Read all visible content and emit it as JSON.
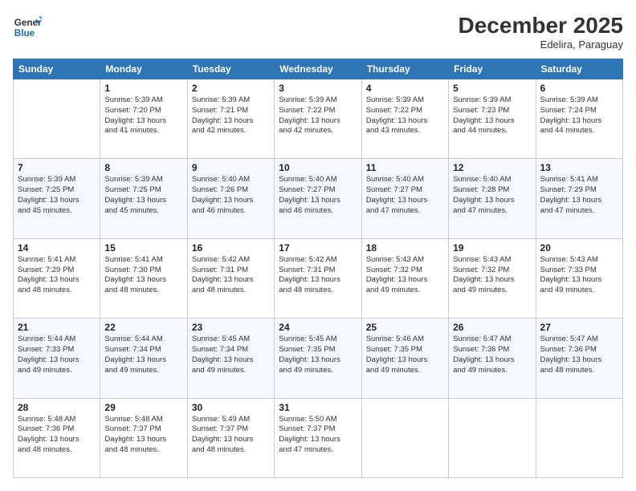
{
  "header": {
    "logo_general": "General",
    "logo_blue": "Blue",
    "month": "December 2025",
    "location": "Edelira, Paraguay"
  },
  "days_of_week": [
    "Sunday",
    "Monday",
    "Tuesday",
    "Wednesday",
    "Thursday",
    "Friday",
    "Saturday"
  ],
  "weeks": [
    [
      {
        "day": "",
        "info": ""
      },
      {
        "day": "1",
        "info": "Sunrise: 5:39 AM\nSunset: 7:20 PM\nDaylight: 13 hours\nand 41 minutes."
      },
      {
        "day": "2",
        "info": "Sunrise: 5:39 AM\nSunset: 7:21 PM\nDaylight: 13 hours\nand 42 minutes."
      },
      {
        "day": "3",
        "info": "Sunrise: 5:39 AM\nSunset: 7:22 PM\nDaylight: 13 hours\nand 42 minutes."
      },
      {
        "day": "4",
        "info": "Sunrise: 5:39 AM\nSunset: 7:22 PM\nDaylight: 13 hours\nand 43 minutes."
      },
      {
        "day": "5",
        "info": "Sunrise: 5:39 AM\nSunset: 7:23 PM\nDaylight: 13 hours\nand 44 minutes."
      },
      {
        "day": "6",
        "info": "Sunrise: 5:39 AM\nSunset: 7:24 PM\nDaylight: 13 hours\nand 44 minutes."
      }
    ],
    [
      {
        "day": "7",
        "info": "Sunrise: 5:39 AM\nSunset: 7:25 PM\nDaylight: 13 hours\nand 45 minutes."
      },
      {
        "day": "8",
        "info": "Sunrise: 5:39 AM\nSunset: 7:25 PM\nDaylight: 13 hours\nand 45 minutes."
      },
      {
        "day": "9",
        "info": "Sunrise: 5:40 AM\nSunset: 7:26 PM\nDaylight: 13 hours\nand 46 minutes."
      },
      {
        "day": "10",
        "info": "Sunrise: 5:40 AM\nSunset: 7:27 PM\nDaylight: 13 hours\nand 46 minutes."
      },
      {
        "day": "11",
        "info": "Sunrise: 5:40 AM\nSunset: 7:27 PM\nDaylight: 13 hours\nand 47 minutes."
      },
      {
        "day": "12",
        "info": "Sunrise: 5:40 AM\nSunset: 7:28 PM\nDaylight: 13 hours\nand 47 minutes."
      },
      {
        "day": "13",
        "info": "Sunrise: 5:41 AM\nSunset: 7:29 PM\nDaylight: 13 hours\nand 47 minutes."
      }
    ],
    [
      {
        "day": "14",
        "info": "Sunrise: 5:41 AM\nSunset: 7:29 PM\nDaylight: 13 hours\nand 48 minutes."
      },
      {
        "day": "15",
        "info": "Sunrise: 5:41 AM\nSunset: 7:30 PM\nDaylight: 13 hours\nand 48 minutes."
      },
      {
        "day": "16",
        "info": "Sunrise: 5:42 AM\nSunset: 7:31 PM\nDaylight: 13 hours\nand 48 minutes."
      },
      {
        "day": "17",
        "info": "Sunrise: 5:42 AM\nSunset: 7:31 PM\nDaylight: 13 hours\nand 48 minutes."
      },
      {
        "day": "18",
        "info": "Sunrise: 5:43 AM\nSunset: 7:32 PM\nDaylight: 13 hours\nand 49 minutes."
      },
      {
        "day": "19",
        "info": "Sunrise: 5:43 AM\nSunset: 7:32 PM\nDaylight: 13 hours\nand 49 minutes."
      },
      {
        "day": "20",
        "info": "Sunrise: 5:43 AM\nSunset: 7:33 PM\nDaylight: 13 hours\nand 49 minutes."
      }
    ],
    [
      {
        "day": "21",
        "info": "Sunrise: 5:44 AM\nSunset: 7:33 PM\nDaylight: 13 hours\nand 49 minutes."
      },
      {
        "day": "22",
        "info": "Sunrise: 5:44 AM\nSunset: 7:34 PM\nDaylight: 13 hours\nand 49 minutes."
      },
      {
        "day": "23",
        "info": "Sunrise: 5:45 AM\nSunset: 7:34 PM\nDaylight: 13 hours\nand 49 minutes."
      },
      {
        "day": "24",
        "info": "Sunrise: 5:45 AM\nSunset: 7:35 PM\nDaylight: 13 hours\nand 49 minutes."
      },
      {
        "day": "25",
        "info": "Sunrise: 5:46 AM\nSunset: 7:35 PM\nDaylight: 13 hours\nand 49 minutes."
      },
      {
        "day": "26",
        "info": "Sunrise: 5:47 AM\nSunset: 7:36 PM\nDaylight: 13 hours\nand 49 minutes."
      },
      {
        "day": "27",
        "info": "Sunrise: 5:47 AM\nSunset: 7:36 PM\nDaylight: 13 hours\nand 48 minutes."
      }
    ],
    [
      {
        "day": "28",
        "info": "Sunrise: 5:48 AM\nSunset: 7:36 PM\nDaylight: 13 hours\nand 48 minutes."
      },
      {
        "day": "29",
        "info": "Sunrise: 5:48 AM\nSunset: 7:37 PM\nDaylight: 13 hours\nand 48 minutes."
      },
      {
        "day": "30",
        "info": "Sunrise: 5:49 AM\nSunset: 7:37 PM\nDaylight: 13 hours\nand 48 minutes."
      },
      {
        "day": "31",
        "info": "Sunrise: 5:50 AM\nSunset: 7:37 PM\nDaylight: 13 hours\nand 47 minutes."
      },
      {
        "day": "",
        "info": ""
      },
      {
        "day": "",
        "info": ""
      },
      {
        "day": "",
        "info": ""
      }
    ]
  ]
}
